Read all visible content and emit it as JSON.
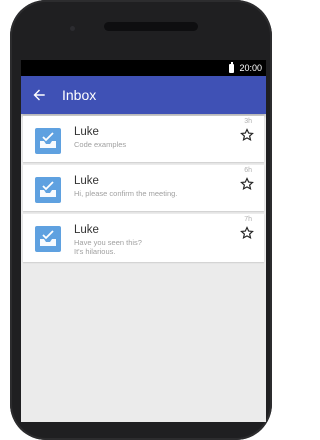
{
  "status_bar": {
    "time": "20:00"
  },
  "app_bar": {
    "title": "Inbox"
  },
  "messages": [
    {
      "sender": "Luke",
      "preview": "Code examples",
      "time": "3h",
      "starred": false
    },
    {
      "sender": "Luke",
      "preview": "Hi, please confirm the meeting.",
      "time": "6h",
      "starred": false
    },
    {
      "sender": "Luke",
      "preview": "Have you seen this?\nIt's hilarious.",
      "time": "7h",
      "starred": false
    }
  ],
  "icons": {
    "back": "arrow-left-icon",
    "star": "star-outline-icon",
    "avatar": "inbox-check-icon",
    "battery": "battery-icon"
  },
  "colors": {
    "app_bar": "#3f51b5",
    "avatar": "#5fa1e0",
    "screen_background": "#ebebeb"
  }
}
